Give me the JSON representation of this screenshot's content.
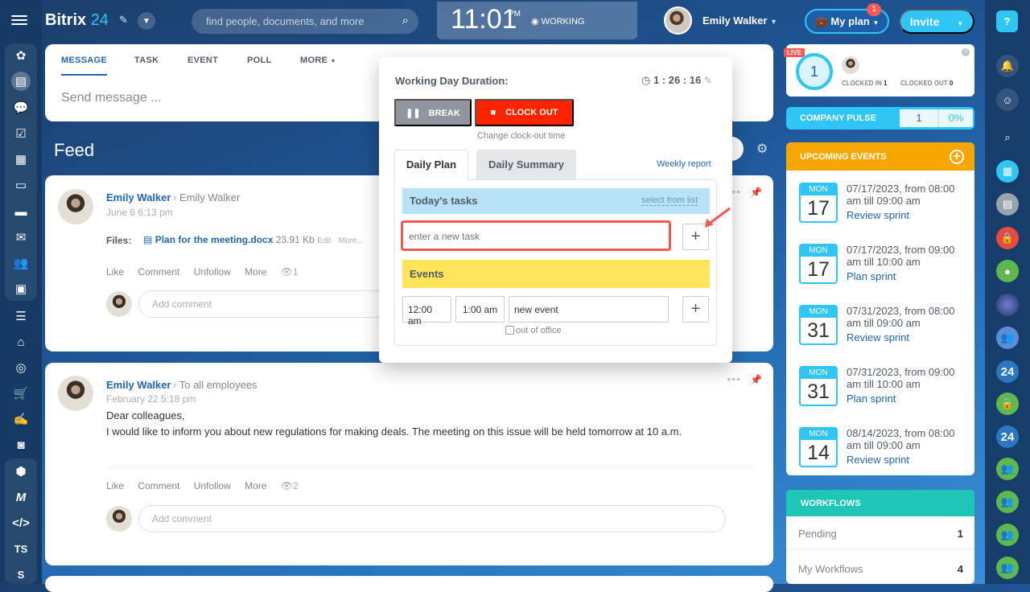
{
  "header": {
    "logo": {
      "brand": "Bitrix",
      "number": "24"
    },
    "search_placeholder": "find people, documents, and more",
    "clock": {
      "time": "11:01",
      "ampm": "PM",
      "status": "WORKING"
    },
    "user_name": "Emily Walker",
    "myplan_label": "My plan",
    "myplan_badge": "1",
    "invite_label": "Invite",
    "help_label": "?"
  },
  "composer": {
    "tabs": [
      "MESSAGE",
      "TASK",
      "EVENT",
      "POLL",
      "MORE"
    ],
    "placeholder": "Send message ..."
  },
  "feed": {
    "title": "Feed",
    "posts": [
      {
        "author": "Emily Walker",
        "destination": "Emily Walker",
        "date": "June 6 6:13 pm",
        "files_label": "Files:",
        "file_name": "Plan for the meeting.docx",
        "file_size": "23.91 Kb",
        "file_edit": "Edit",
        "file_more": "More...",
        "actions": [
          "Like",
          "Comment",
          "Unfollow",
          "More"
        ],
        "views": "1",
        "comment_placeholder": "Add comment"
      },
      {
        "author": "Emily Walker",
        "destination": "To all employees",
        "date": "February 22 5:18 pm",
        "body_1": "Dear colleagues,",
        "body_2": "I would like to inform you about new regulations for making deals. The meeting on this issue will be held tomorrow at 10 a.m.",
        "actions": [
          "Like",
          "Comment",
          "Unfollow",
          "More"
        ],
        "views": "2",
        "comment_placeholder": "Add comment"
      }
    ]
  },
  "workday_popup": {
    "duration_label": "Working Day Duration:",
    "duration_value": "1 : 26 : 16",
    "break_label": "BREAK",
    "clockout_label": "CLOCK OUT",
    "change_time": "Change clock-out time",
    "tabs": [
      "Daily Plan",
      "Daily Summary"
    ],
    "weekly_report": "Weekly report",
    "tasks_header": "Today's tasks",
    "select_from_list": "select from list",
    "task_placeholder": "enter a new task",
    "events_header": "Events",
    "event_start": "12:00 am",
    "event_end": "1:00 am",
    "event_placeholder": "new event",
    "out_of_office": "out of office"
  },
  "live": {
    "tag": "LIVE",
    "ring_value": "1",
    "clocked_in_label": "CLOCKED IN",
    "clocked_in": "1",
    "clocked_out_label": "CLOCKED OUT",
    "clocked_out": "0"
  },
  "pulse": {
    "label": "COMPANY PULSE",
    "value": "1",
    "percent": "0%"
  },
  "upcoming": {
    "title": "UPCOMING EVENTS",
    "events": [
      {
        "month": "MON",
        "day": "17",
        "line1": "07/17/2023, from 08:00",
        "line2": "am till 09:00 am",
        "title": "Review sprint"
      },
      {
        "month": "MON",
        "day": "17",
        "line1": "07/17/2023, from 09:00",
        "line2": "am till 10:00 am",
        "title": "Plan sprint"
      },
      {
        "month": "MON",
        "day": "31",
        "line1": "07/31/2023, from 08:00",
        "line2": "am till 09:00 am",
        "title": "Review sprint"
      },
      {
        "month": "MON",
        "day": "31",
        "line1": "07/31/2023, from 09:00",
        "line2": "am till 10:00 am",
        "title": "Plan sprint"
      },
      {
        "month": "MON",
        "day": "14",
        "line1": "08/14/2023, from 08:00",
        "line2": "am till 09:00 am",
        "title": "Review sprint"
      }
    ]
  },
  "workflows": {
    "title": "WORKFLOWS",
    "rows": [
      {
        "label": "Pending",
        "count": "1"
      },
      {
        "label": "My Workflows",
        "count": "4"
      }
    ]
  },
  "leftbar": {
    "ts_label": "TS",
    "s_label": "S"
  },
  "rightbar": {
    "badge_24a": "24",
    "badge_24b": "24"
  },
  "colors": {
    "accent": "#2fc6f6",
    "clockout": "#ff2400",
    "events_yellow": "#ffe35a",
    "upcoming_orange": "#f7a700",
    "workflows_teal": "#1ec6b5",
    "highlight": "#ee5a4f"
  }
}
